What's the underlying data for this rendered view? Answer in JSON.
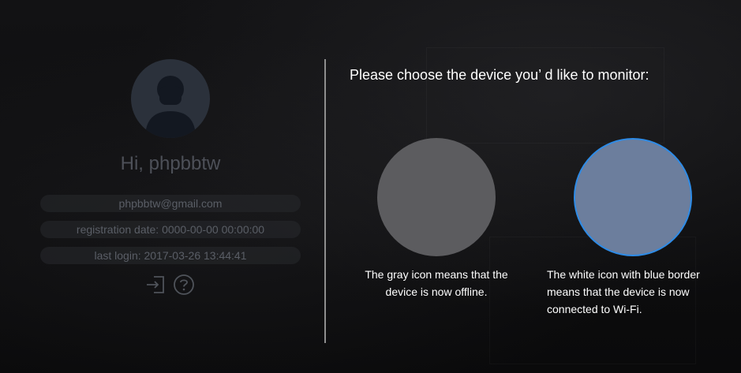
{
  "profile": {
    "greeting": "Hi, phpbbtw",
    "email": "phpbbtw@gmail.com",
    "registration_date": "registration date: 0000-00-00 00:00:00",
    "last_login": "last login: 2017-03-26 13:44:41",
    "avatar_icon": "user-silhouette-icon",
    "logout_icon": "logout-icon",
    "help_icon": "question-mark-icon"
  },
  "main": {
    "prompt": "Please choose the device you’ d like to monitor:",
    "devices": [
      {
        "status": "offline",
        "color": "#5c5c5f",
        "caption": "The gray icon means that the device is now offline."
      },
      {
        "status": "connected",
        "color": "#6c7e9d",
        "border_color": "#2e8be6",
        "caption": "The white icon with blue border means that the device is now connected to Wi-Fi."
      }
    ]
  }
}
